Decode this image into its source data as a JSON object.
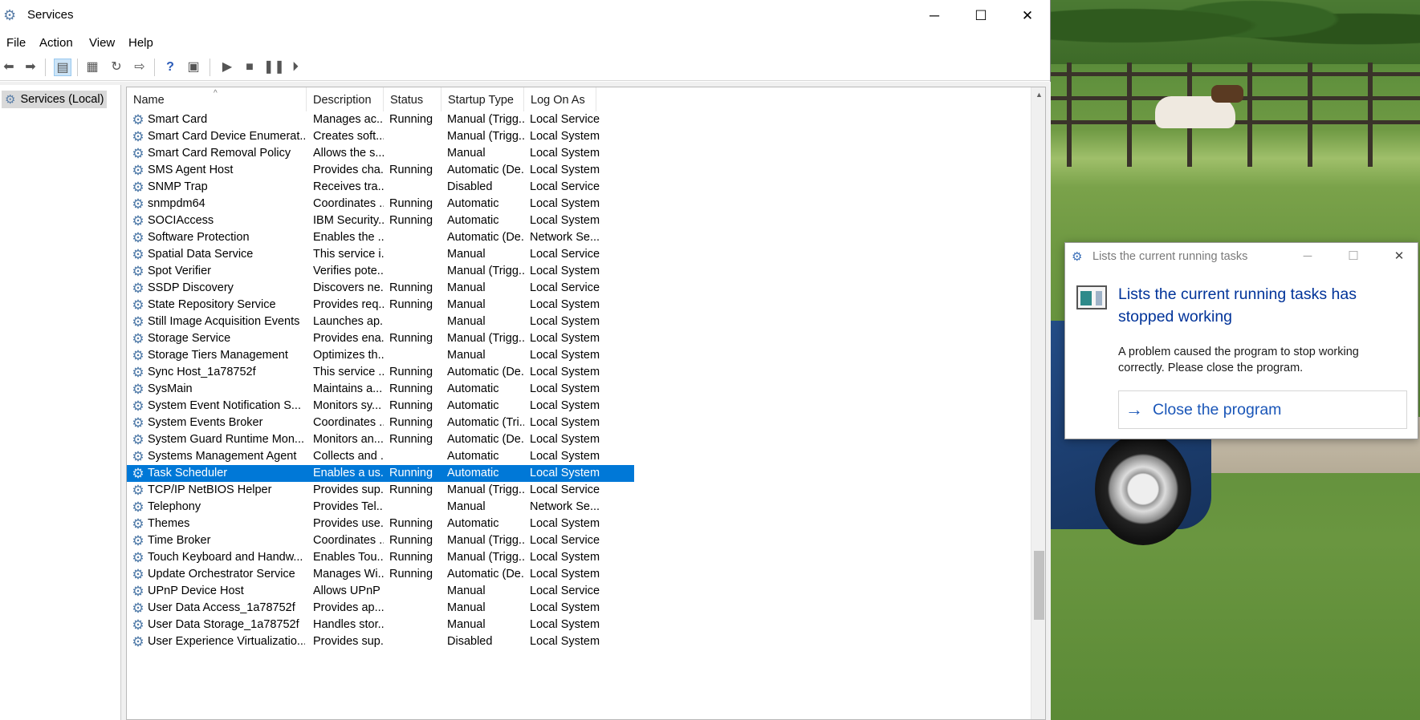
{
  "window": {
    "title": "Services",
    "controls": {
      "minimize": "─",
      "maximize": "☐",
      "close": "✕"
    }
  },
  "menu": [
    "File",
    "Action",
    "View",
    "Help"
  ],
  "tree": {
    "root_label": "Services (Local)"
  },
  "columns": [
    "Name",
    "Description",
    "Status",
    "Startup Type",
    "Log On As"
  ],
  "sort_indicator": "^",
  "rows": [
    {
      "name": "Smart Card",
      "description": "Manages ac...",
      "status": "Running",
      "startup": "Manual (Trigg...",
      "logon": "Local Service"
    },
    {
      "name": "Smart Card Device Enumerat...",
      "description": "Creates soft...",
      "status": "",
      "startup": "Manual (Trigg...",
      "logon": "Local System"
    },
    {
      "name": "Smart Card Removal Policy",
      "description": "Allows the s...",
      "status": "",
      "startup": "Manual",
      "logon": "Local System"
    },
    {
      "name": "SMS Agent Host",
      "description": "Provides cha...",
      "status": "Running",
      "startup": "Automatic (De...",
      "logon": "Local System"
    },
    {
      "name": "SNMP Trap",
      "description": "Receives tra...",
      "status": "",
      "startup": "Disabled",
      "logon": "Local Service"
    },
    {
      "name": "snmpdm64",
      "description": "Coordinates ...",
      "status": "Running",
      "startup": "Automatic",
      "logon": "Local System"
    },
    {
      "name": "SOCIAccess",
      "description": "IBM Security...",
      "status": "Running",
      "startup": "Automatic",
      "logon": "Local System"
    },
    {
      "name": "Software Protection",
      "description": "Enables the ...",
      "status": "",
      "startup": "Automatic (De...",
      "logon": "Network Se..."
    },
    {
      "name": "Spatial Data Service",
      "description": "This service i...",
      "status": "",
      "startup": "Manual",
      "logon": "Local Service"
    },
    {
      "name": "Spot Verifier",
      "description": "Verifies pote...",
      "status": "",
      "startup": "Manual (Trigg...",
      "logon": "Local System"
    },
    {
      "name": "SSDP Discovery",
      "description": "Discovers ne...",
      "status": "Running",
      "startup": "Manual",
      "logon": "Local Service"
    },
    {
      "name": "State Repository Service",
      "description": "Provides req...",
      "status": "Running",
      "startup": "Manual",
      "logon": "Local System"
    },
    {
      "name": "Still Image Acquisition Events",
      "description": "Launches ap...",
      "status": "",
      "startup": "Manual",
      "logon": "Local System"
    },
    {
      "name": "Storage Service",
      "description": "Provides ena...",
      "status": "Running",
      "startup": "Manual (Trigg...",
      "logon": "Local System"
    },
    {
      "name": "Storage Tiers Management",
      "description": "Optimizes th...",
      "status": "",
      "startup": "Manual",
      "logon": "Local System"
    },
    {
      "name": "Sync Host_1a78752f",
      "description": "This service ...",
      "status": "Running",
      "startup": "Automatic (De...",
      "logon": "Local System"
    },
    {
      "name": "SysMain",
      "description": "Maintains a...",
      "status": "Running",
      "startup": "Automatic",
      "logon": "Local System"
    },
    {
      "name": "System Event Notification S...",
      "description": "Monitors sy...",
      "status": "Running",
      "startup": "Automatic",
      "logon": "Local System"
    },
    {
      "name": "System Events Broker",
      "description": "Coordinates ...",
      "status": "Running",
      "startup": "Automatic (Tri...",
      "logon": "Local System"
    },
    {
      "name": "System Guard Runtime Mon...",
      "description": "Monitors an...",
      "status": "Running",
      "startup": "Automatic (De...",
      "logon": "Local System"
    },
    {
      "name": "Systems Management Agent",
      "description": "Collects and ...",
      "status": "",
      "startup": "Automatic",
      "logon": "Local System"
    },
    {
      "name": "Task Scheduler",
      "description": "Enables a us...",
      "status": "Running",
      "startup": "Automatic",
      "logon": "Local System",
      "selected": true
    },
    {
      "name": "TCP/IP NetBIOS Helper",
      "description": "Provides sup...",
      "status": "Running",
      "startup": "Manual (Trigg...",
      "logon": "Local Service"
    },
    {
      "name": "Telephony",
      "description": "Provides Tel...",
      "status": "",
      "startup": "Manual",
      "logon": "Network Se..."
    },
    {
      "name": "Themes",
      "description": "Provides use...",
      "status": "Running",
      "startup": "Automatic",
      "logon": "Local System"
    },
    {
      "name": "Time Broker",
      "description": "Coordinates ...",
      "status": "Running",
      "startup": "Manual (Trigg...",
      "logon": "Local Service"
    },
    {
      "name": "Touch Keyboard and Handw...",
      "description": "Enables Tou...",
      "status": "Running",
      "startup": "Manual (Trigg...",
      "logon": "Local System"
    },
    {
      "name": "Update Orchestrator Service",
      "description": "Manages Wi...",
      "status": "Running",
      "startup": "Automatic (De...",
      "logon": "Local System"
    },
    {
      "name": "UPnP Device Host",
      "description": "Allows UPnP ...",
      "status": "",
      "startup": "Manual",
      "logon": "Local Service"
    },
    {
      "name": "User Data Access_1a78752f",
      "description": "Provides ap...",
      "status": "",
      "startup": "Manual",
      "logon": "Local System"
    },
    {
      "name": "User Data Storage_1a78752f",
      "description": "Handles stor...",
      "status": "",
      "startup": "Manual",
      "logon": "Local System"
    },
    {
      "name": "User Experience Virtualizatio...",
      "description": "Provides sup...",
      "status": "",
      "startup": "Disabled",
      "logon": "Local System"
    }
  ],
  "scrollbar": {
    "position": 0.74
  },
  "dialog": {
    "title": "Lists the current running tasks",
    "headline": "Lists the current running tasks has stopped working",
    "message": "A problem caused the program to stop working correctly. Please close the program.",
    "action": "Close the program",
    "controls": {
      "minimize": "─",
      "maximize": "☐",
      "close": "✕"
    }
  },
  "colors": {
    "selection": "#0078d7",
    "dialog_heading": "#003399",
    "dialog_action": "#1a56b8"
  }
}
